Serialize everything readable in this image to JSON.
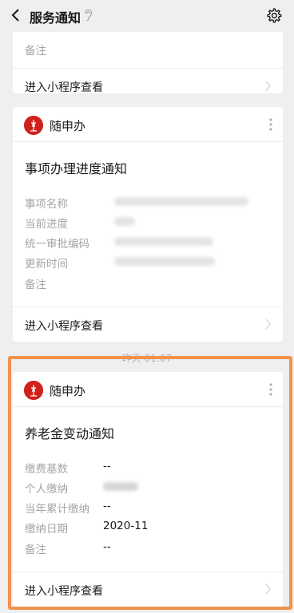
{
  "header": {
    "title": "服务通知"
  },
  "cards": [
    {
      "rows": [
        {
          "label": "备注",
          "value": ""
        }
      ],
      "footer_label": "进入小程序查看"
    },
    {
      "app_name": "随申办",
      "title": "事项办理进度通知",
      "rows": [
        {
          "label": "事项名称",
          "value": ""
        },
        {
          "label": "当前进度",
          "value": ""
        },
        {
          "label": "统一审批编码",
          "value": ""
        },
        {
          "label": "更新时间",
          "value": ""
        },
        {
          "label": "备注",
          "value": ""
        }
      ],
      "footer_label": "进入小程序查看"
    },
    {
      "app_name": "随申办",
      "title": "养老金变动通知",
      "rows": [
        {
          "label": "缴费基数",
          "value": "--"
        },
        {
          "label": "个人缴纳",
          "value": ""
        },
        {
          "label": "当年累计缴纳",
          "value": "--"
        },
        {
          "label": "缴纳日期",
          "value": "2020-11"
        },
        {
          "label": "备注",
          "value": "--"
        }
      ],
      "footer_label": "进入小程序查看"
    }
  ],
  "timestamp": "昨天 01:07",
  "colors": {
    "background": "#efefef",
    "card": "#ffffff",
    "label_gray": "#a6a6a6",
    "highlight_orange": "#f0934c",
    "logo_red": "#d0211c"
  }
}
